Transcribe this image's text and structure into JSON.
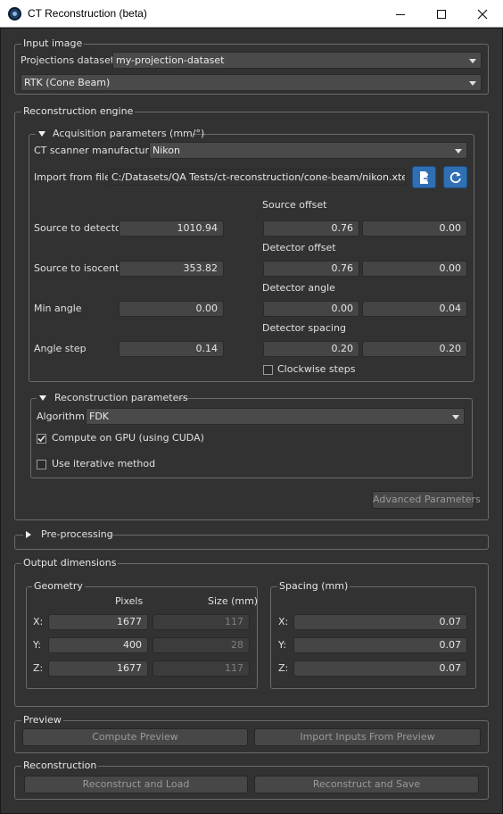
{
  "window": {
    "title": "CT Reconstruction (beta)"
  },
  "input_image": {
    "group_title": "Input image",
    "projections_label": "Projections dataset:",
    "projections_value": "my-projection-dataset",
    "method_value": "RTK (Cone Beam)"
  },
  "engine": {
    "group_title": "Reconstruction engine",
    "acquisition": {
      "title": "Acquisition parameters (mm/°)",
      "manufacturer_label": "CT scanner manufacturer",
      "manufacturer_value": "Nikon",
      "import_label": "Import from file",
      "import_path": "C:/Datasets/QA Tests/ct-reconstruction/cone-beam/nikon.xtekct",
      "source_to_detector_label": "Source to detector",
      "source_to_detector": "1010.94",
      "source_to_isocenter_label": "Source to isocenter",
      "source_to_isocenter": "353.82",
      "min_angle_label": "Min angle",
      "min_angle": "0.00",
      "angle_step_label": "Angle step",
      "angle_step": "0.14",
      "source_offset_label": "Source offset",
      "source_offset": [
        "0.76",
        "0.00"
      ],
      "detector_offset_label": "Detector offset",
      "detector_offset": [
        "0.76",
        "0.00"
      ],
      "detector_angle_label": "Detector angle",
      "detector_angle": [
        "0.00",
        "0.04"
      ],
      "detector_spacing_label": "Detector spacing",
      "detector_spacing": [
        "0.20",
        "0.20"
      ],
      "clockwise_label": "Clockwise steps",
      "clockwise_checked": false
    },
    "reconstruction": {
      "title": "Reconstruction parameters",
      "algorithm_label": "Algorithm:",
      "algorithm_value": "FDK",
      "gpu_label": "Compute on GPU (using CUDA)",
      "gpu_checked": true,
      "iterative_label": "Use iterative method",
      "iterative_checked": false
    },
    "advanced_button": "Advanced Parameters"
  },
  "preprocessing": {
    "title": "Pre-processing"
  },
  "output": {
    "group_title": "Output dimensions",
    "geometry_title": "Geometry",
    "pixels_header": "Pixels",
    "size_header": "Size (mm)",
    "rows": [
      {
        "axis": "X:",
        "pixels": "1677",
        "size": "117"
      },
      {
        "axis": "Y:",
        "pixels": "400",
        "size": "28"
      },
      {
        "axis": "Z:",
        "pixels": "1677",
        "size": "117"
      }
    ],
    "spacing_title": "Spacing (mm)",
    "spacing_rows": [
      {
        "axis": "X:",
        "value": "0.07"
      },
      {
        "axis": "Y:",
        "value": "0.07"
      },
      {
        "axis": "Z:",
        "value": "0.07"
      }
    ]
  },
  "preview": {
    "group_title": "Preview",
    "compute_button": "Compute Preview",
    "import_button": "Import Inputs From Preview"
  },
  "reconstruction_section": {
    "group_title": "Reconstruction",
    "load_button": "Reconstruct and Load",
    "save_button": "Reconstruct and Save"
  },
  "colors": {
    "background": "#323232",
    "accent": "#2f6fb3",
    "border": "#6a6a6a"
  }
}
